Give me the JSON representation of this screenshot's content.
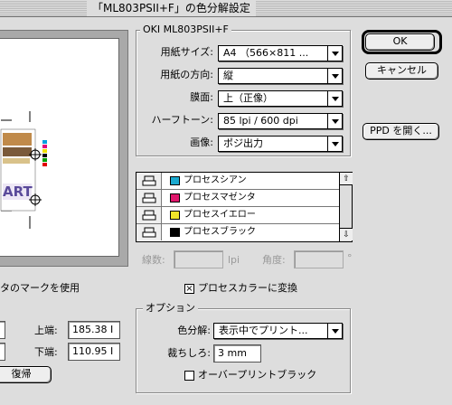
{
  "window": {
    "title": "「ML803PSII+F」の色分解設定"
  },
  "printer": {
    "name": "OKI ML803PSII+F",
    "fields": [
      {
        "label": "用紙サイズ:",
        "value": "A4 （566×811 ..."
      },
      {
        "label": "用紙の方向:",
        "value": "縦"
      },
      {
        "label": "膜面:",
        "value": "上（正像）"
      },
      {
        "label": "ハーフトーン:",
        "value": "85 lpi / 600 dpi"
      },
      {
        "label": "画像:",
        "value": "ポジ出力"
      }
    ]
  },
  "buttons": {
    "ok": "OK",
    "cancel": "キャンセル",
    "ppd": "PPD を開く...",
    "reset": "復帰"
  },
  "plates": [
    {
      "name": "プロセスシアン",
      "color": "#1aa9cf"
    },
    {
      "name": "プロセスマゼンタ",
      "color": "#e0186c"
    },
    {
      "name": "プロセスイエロー",
      "color": "#f0e52a"
    },
    {
      "name": "プロセスブラック",
      "color": "#000000"
    }
  ],
  "screen": {
    "frequency_label": "線数:",
    "frequency_value": "",
    "frequency_unit": "lpi",
    "angle_label": "角度:",
    "angle_value": "",
    "angle_unit": "°"
  },
  "process_convert": {
    "checked": true,
    "label": "プロセスカラーに変換",
    "mark": "×"
  },
  "marks": {
    "use_label": "タのマークを使用"
  },
  "margins": {
    "top_label": "上端:",
    "top_value": "185.38 I",
    "bottom_label": "下端:",
    "bottom_value": "110.95 I"
  },
  "options": {
    "group_label": "オプション",
    "separation_label": "色分解:",
    "separation_value": "表示中でプリント...",
    "bleed_label": "裁ちしろ:",
    "bleed_value": "3 mm",
    "overprint_label": "オーバープリントブラック",
    "overprint_checked": false
  },
  "preview_art": {
    "text": "ART"
  }
}
